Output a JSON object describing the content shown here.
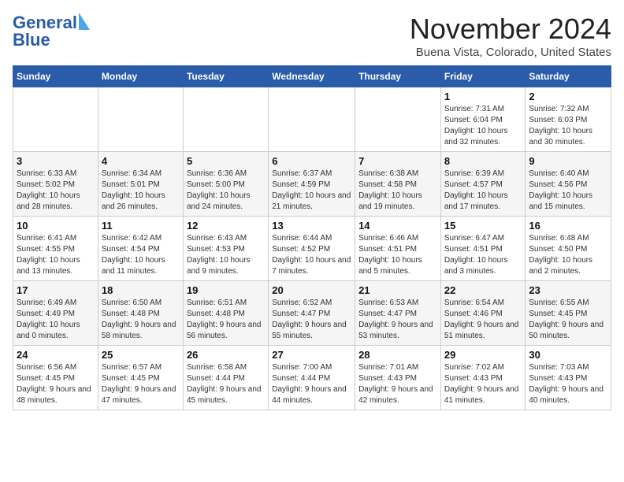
{
  "header": {
    "logo_line1": "General",
    "logo_line2": "Blue",
    "month_title": "November 2024",
    "subtitle": "Buena Vista, Colorado, United States"
  },
  "columns": [
    "Sunday",
    "Monday",
    "Tuesday",
    "Wednesday",
    "Thursday",
    "Friday",
    "Saturday"
  ],
  "weeks": [
    [
      {
        "day": "",
        "info": ""
      },
      {
        "day": "",
        "info": ""
      },
      {
        "day": "",
        "info": ""
      },
      {
        "day": "",
        "info": ""
      },
      {
        "day": "",
        "info": ""
      },
      {
        "day": "1",
        "info": "Sunrise: 7:31 AM\nSunset: 6:04 PM\nDaylight: 10 hours and 32 minutes."
      },
      {
        "day": "2",
        "info": "Sunrise: 7:32 AM\nSunset: 6:03 PM\nDaylight: 10 hours and 30 minutes."
      }
    ],
    [
      {
        "day": "3",
        "info": "Sunrise: 6:33 AM\nSunset: 5:02 PM\nDaylight: 10 hours and 28 minutes."
      },
      {
        "day": "4",
        "info": "Sunrise: 6:34 AM\nSunset: 5:01 PM\nDaylight: 10 hours and 26 minutes."
      },
      {
        "day": "5",
        "info": "Sunrise: 6:36 AM\nSunset: 5:00 PM\nDaylight: 10 hours and 24 minutes."
      },
      {
        "day": "6",
        "info": "Sunrise: 6:37 AM\nSunset: 4:59 PM\nDaylight: 10 hours and 21 minutes."
      },
      {
        "day": "7",
        "info": "Sunrise: 6:38 AM\nSunset: 4:58 PM\nDaylight: 10 hours and 19 minutes."
      },
      {
        "day": "8",
        "info": "Sunrise: 6:39 AM\nSunset: 4:57 PM\nDaylight: 10 hours and 17 minutes."
      },
      {
        "day": "9",
        "info": "Sunrise: 6:40 AM\nSunset: 4:56 PM\nDaylight: 10 hours and 15 minutes."
      }
    ],
    [
      {
        "day": "10",
        "info": "Sunrise: 6:41 AM\nSunset: 4:55 PM\nDaylight: 10 hours and 13 minutes."
      },
      {
        "day": "11",
        "info": "Sunrise: 6:42 AM\nSunset: 4:54 PM\nDaylight: 10 hours and 11 minutes."
      },
      {
        "day": "12",
        "info": "Sunrise: 6:43 AM\nSunset: 4:53 PM\nDaylight: 10 hours and 9 minutes."
      },
      {
        "day": "13",
        "info": "Sunrise: 6:44 AM\nSunset: 4:52 PM\nDaylight: 10 hours and 7 minutes."
      },
      {
        "day": "14",
        "info": "Sunrise: 6:46 AM\nSunset: 4:51 PM\nDaylight: 10 hours and 5 minutes."
      },
      {
        "day": "15",
        "info": "Sunrise: 6:47 AM\nSunset: 4:51 PM\nDaylight: 10 hours and 3 minutes."
      },
      {
        "day": "16",
        "info": "Sunrise: 6:48 AM\nSunset: 4:50 PM\nDaylight: 10 hours and 2 minutes."
      }
    ],
    [
      {
        "day": "17",
        "info": "Sunrise: 6:49 AM\nSunset: 4:49 PM\nDaylight: 10 hours and 0 minutes."
      },
      {
        "day": "18",
        "info": "Sunrise: 6:50 AM\nSunset: 4:48 PM\nDaylight: 9 hours and 58 minutes."
      },
      {
        "day": "19",
        "info": "Sunrise: 6:51 AM\nSunset: 4:48 PM\nDaylight: 9 hours and 56 minutes."
      },
      {
        "day": "20",
        "info": "Sunrise: 6:52 AM\nSunset: 4:47 PM\nDaylight: 9 hours and 55 minutes."
      },
      {
        "day": "21",
        "info": "Sunrise: 6:53 AM\nSunset: 4:47 PM\nDaylight: 9 hours and 53 minutes."
      },
      {
        "day": "22",
        "info": "Sunrise: 6:54 AM\nSunset: 4:46 PM\nDaylight: 9 hours and 51 minutes."
      },
      {
        "day": "23",
        "info": "Sunrise: 6:55 AM\nSunset: 4:45 PM\nDaylight: 9 hours and 50 minutes."
      }
    ],
    [
      {
        "day": "24",
        "info": "Sunrise: 6:56 AM\nSunset: 4:45 PM\nDaylight: 9 hours and 48 minutes."
      },
      {
        "day": "25",
        "info": "Sunrise: 6:57 AM\nSunset: 4:45 PM\nDaylight: 9 hours and 47 minutes."
      },
      {
        "day": "26",
        "info": "Sunrise: 6:58 AM\nSunset: 4:44 PM\nDaylight: 9 hours and 45 minutes."
      },
      {
        "day": "27",
        "info": "Sunrise: 7:00 AM\nSunset: 4:44 PM\nDaylight: 9 hours and 44 minutes."
      },
      {
        "day": "28",
        "info": "Sunrise: 7:01 AM\nSunset: 4:43 PM\nDaylight: 9 hours and 42 minutes."
      },
      {
        "day": "29",
        "info": "Sunrise: 7:02 AM\nSunset: 4:43 PM\nDaylight: 9 hours and 41 minutes."
      },
      {
        "day": "30",
        "info": "Sunrise: 7:03 AM\nSunset: 4:43 PM\nDaylight: 9 hours and 40 minutes."
      }
    ]
  ]
}
